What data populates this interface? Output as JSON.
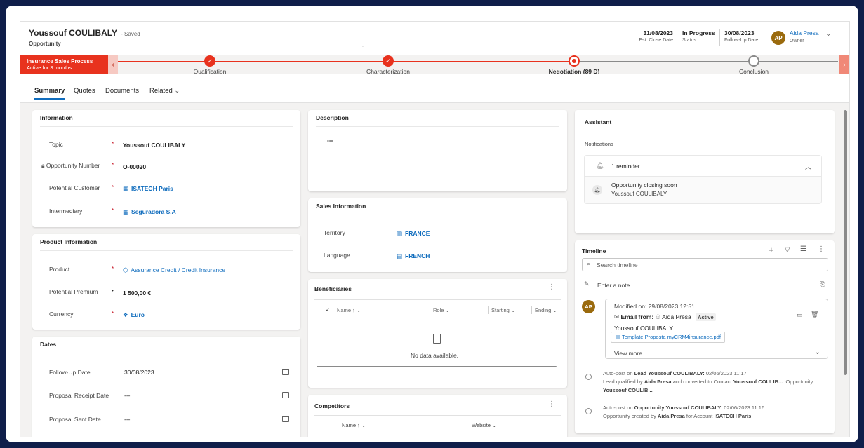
{
  "header": {
    "record_name": "Youssouf COULIBALY",
    "saved_status": "- Saved",
    "entity": "Opportunity",
    "fields": [
      {
        "value": "31/08/2023",
        "label": "Est. Close Date"
      },
      {
        "value": "In Progress",
        "label": "Status"
      },
      {
        "value": "30/08/2023",
        "label": "Follow-Up Date"
      }
    ],
    "owner_initials": "AP",
    "owner_name": "Aida Presa",
    "owner_label": "Owner"
  },
  "bpf": {
    "process_name": "Insurance Sales Process",
    "active_for": "Active for 3 months",
    "stages": [
      {
        "label": "Qualification",
        "state": "done"
      },
      {
        "label": "Characterization",
        "state": "done"
      },
      {
        "label": "Negotiation  (89 D)",
        "state": "active"
      },
      {
        "label": "Conclusion",
        "state": "todo"
      }
    ],
    "colors": {
      "accent": "#e8321e",
      "pending": "#8a8a8a"
    }
  },
  "tabs": [
    "Summary",
    "Quotes",
    "Documents",
    "Related"
  ],
  "information": {
    "title": "Information",
    "rows": [
      {
        "label": "Topic",
        "value": "Youssouf COULIBALY"
      },
      {
        "label": "Opportunity Number",
        "value": "O-00020"
      },
      {
        "label": "Potential Customer",
        "value": "ISATECH Paris"
      },
      {
        "label": "Intermediary",
        "value": "Seguradora S.A"
      }
    ],
    "required_mark": "*"
  },
  "product": {
    "title": "Product Information",
    "rows": [
      {
        "label": "Product",
        "value": "Assurance Credit / Credit Insurance"
      },
      {
        "label": "Potential Premium",
        "value": "1 500,00 €"
      },
      {
        "label": "Currency",
        "value": "Euro"
      }
    ]
  },
  "dates": {
    "title": "Dates",
    "rows": [
      {
        "label": "Follow-Up Date",
        "value": "30/08/2023"
      },
      {
        "label": "Proposal Receipt Date",
        "value": "---"
      },
      {
        "label": "Proposal Sent Date",
        "value": "---"
      }
    ]
  },
  "description": {
    "title": "Description",
    "value": "---"
  },
  "sales": {
    "title": "Sales Information",
    "rows": [
      {
        "label": "Territory",
        "value": "FRANCE"
      },
      {
        "label": "Language",
        "value": "FRENCH"
      }
    ]
  },
  "beneficiaries": {
    "title": "Beneficiaries",
    "columns": [
      "Name",
      "Role",
      "Starting",
      "Ending"
    ],
    "empty": "No data available."
  },
  "competitors": {
    "title": "Competitors",
    "columns": [
      "Name",
      "Website"
    ]
  },
  "assistant": {
    "title": "Assistant",
    "section": "Notifications",
    "reminder": "1 reminder",
    "item_title": "Opportunity closing soon",
    "item_sub": "Youssouf COULIBALY"
  },
  "timeline": {
    "title": "Timeline",
    "search_placeholder": "Search timeline",
    "note_placeholder": "Enter a note...",
    "post": {
      "initials": "AP",
      "modified": "Modified on: 29/08/2023 12:51",
      "email_from": "Email from:",
      "author": "Aida Presa",
      "badge": "Active",
      "subject": "Youssouf COULIBALY",
      "attachment": "Template Proposta myCRM4insurance.pdf",
      "view_more": "View more"
    },
    "autoposts": [
      {
        "prefix": "Auto-post on",
        "entity": "Lead Youssouf COULIBALY:",
        "when": "02/06/2023 11:17",
        "body": [
          "Lead qualified by",
          "Aida Presa",
          "and converted to Contact",
          "Youssouf COULIB...",
          ",Opportunity"
        ],
        "body2": "Youssouf COULIB..."
      },
      {
        "prefix": "Auto-post on",
        "entity": "Opportunity Youssouf COULIBALY:",
        "when": "02/06/2023 11:16",
        "body": [
          "Opportunity created by",
          "Aida Presa",
          "for Account",
          "ISATECH Paris"
        ]
      }
    ]
  }
}
